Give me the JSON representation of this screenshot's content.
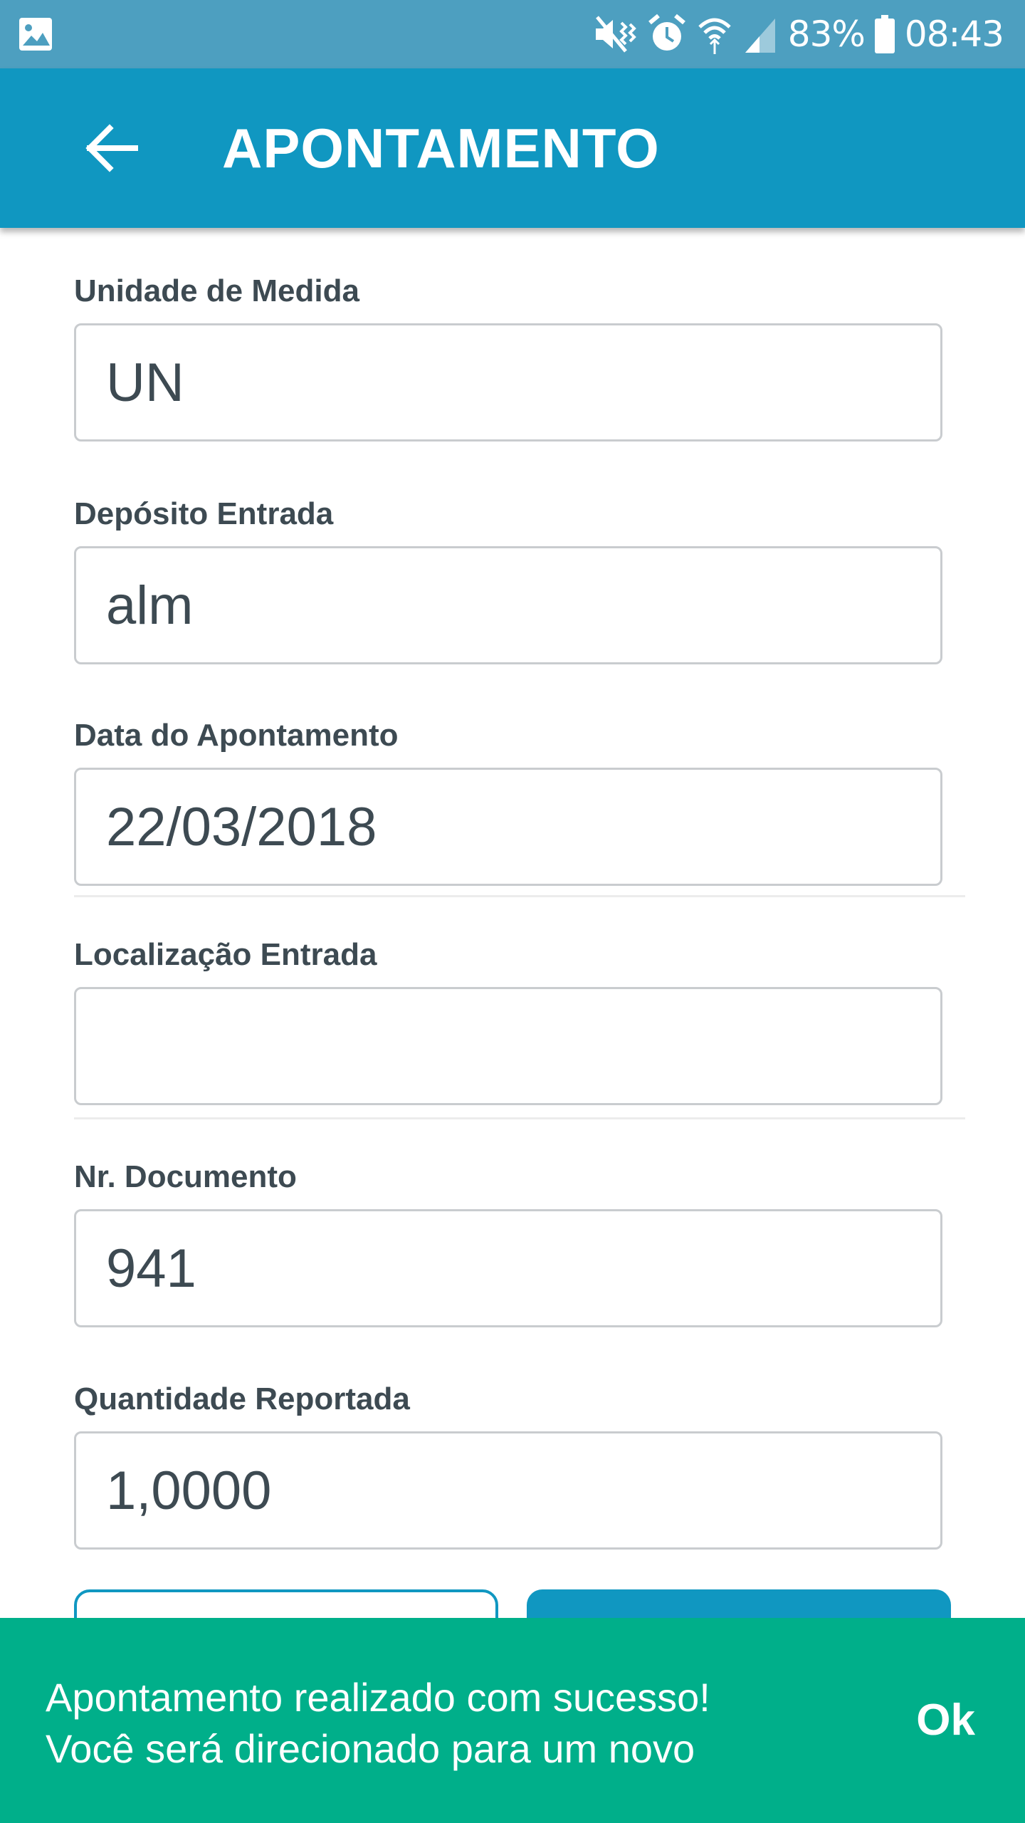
{
  "status_bar": {
    "battery": "83%",
    "time": "08:43",
    "icons": [
      "gallery-icon",
      "vibrate-mute-icon",
      "alarm-icon",
      "wifi-icon",
      "signal-icon",
      "battery-icon"
    ]
  },
  "header": {
    "title": "APONTAMENTO",
    "back_icon": "arrow-left-icon"
  },
  "form": {
    "fields": [
      {
        "label": "Unidade de Medida",
        "value": "UN"
      },
      {
        "label": "Depósito Entrada",
        "value": "alm"
      },
      {
        "label": "Data do Apontamento",
        "value": "22/03/2018"
      },
      {
        "label": "Localização Entrada",
        "value": ""
      },
      {
        "label": "Nr. Documento",
        "value": "941"
      },
      {
        "label": "Quantidade Reportada",
        "value": "1,0000"
      }
    ]
  },
  "snackbar": {
    "line1": "Apontamento realizado com sucesso!",
    "line2": "Você será direcionado para um novo",
    "action": "Ok"
  },
  "colors": {
    "status_bar": "#4d9fc0",
    "app_bar": "#1097c1",
    "snackbar": "#00af8a",
    "text": "#3d4a52",
    "input_border": "#c9cccf"
  }
}
